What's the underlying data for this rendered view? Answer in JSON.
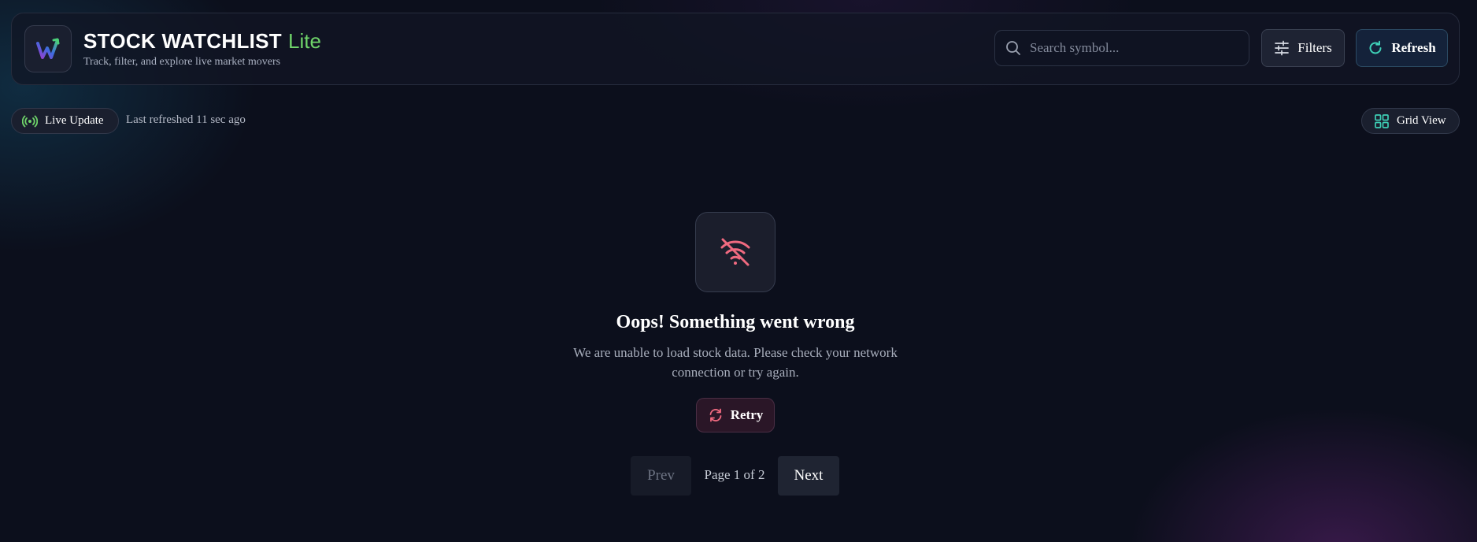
{
  "header": {
    "logo_icon": "w-chart-logo-icon",
    "title": "STOCK WATCHLIST",
    "title_accent": "Lite",
    "subtitle": "Track, filter, and explore live market movers",
    "search": {
      "placeholder": "Search symbol...",
      "value": "",
      "icon": "search-icon"
    },
    "filters_label": "Filters",
    "refresh_label": "Refresh"
  },
  "status": {
    "live_label": "Live Update",
    "last_refreshed": "Last refreshed 11 sec ago",
    "view_label": "Grid View"
  },
  "error": {
    "icon": "wifi-off-icon",
    "title": "Oops! Something went wrong",
    "message": "We are unable to load stock data. Please check your network connection or try again.",
    "retry_label": "Retry"
  },
  "pagination": {
    "prev_label": "Prev",
    "page_info": "Page 1 of 2",
    "next_label": "Next"
  },
  "colors": {
    "background": "#0c0f1c",
    "accent_green": "#6fd46a",
    "error_pink": "#f06a80",
    "teal": "#3ecfb6"
  }
}
